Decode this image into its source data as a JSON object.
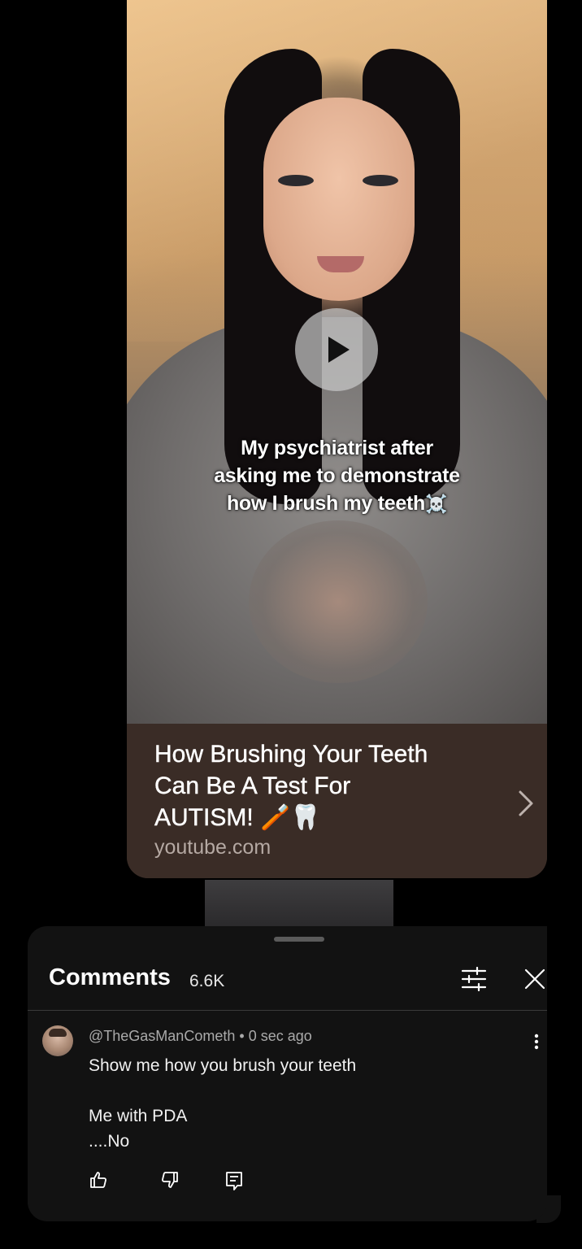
{
  "link_preview": {
    "video_caption_lines": [
      "My psychiatrist after",
      "asking me to demonstrate",
      "how I brush my teeth"
    ],
    "video_caption_emoji": "☠️",
    "title_lines": [
      "How Brushing Your Teeth",
      "Can Be A Test For",
      "AUTISM! 🪥🦷"
    ],
    "domain": "youtube.com",
    "play_icon": "play-icon",
    "chevron_icon": "chevron-right-icon"
  },
  "comments_panel": {
    "title": "Comments",
    "count": "6.6K",
    "filter_icon": "filter-sliders-icon",
    "close_icon": "close-icon",
    "comment": {
      "author": "@TheGasManCometh",
      "separator": "•",
      "time": "0 sec ago",
      "text": "Show me how you brush your teeth\n\nMe with PDA\n....No",
      "actions": [
        "like-icon",
        "dislike-icon",
        "reply-icon"
      ],
      "more_icon": "more-vertical-icon"
    }
  },
  "colors": {
    "page_bg": "#000000",
    "card_info_bg": "#3a2c26",
    "panel_bg": "#121212",
    "meta_text": "#aaaaaa"
  }
}
